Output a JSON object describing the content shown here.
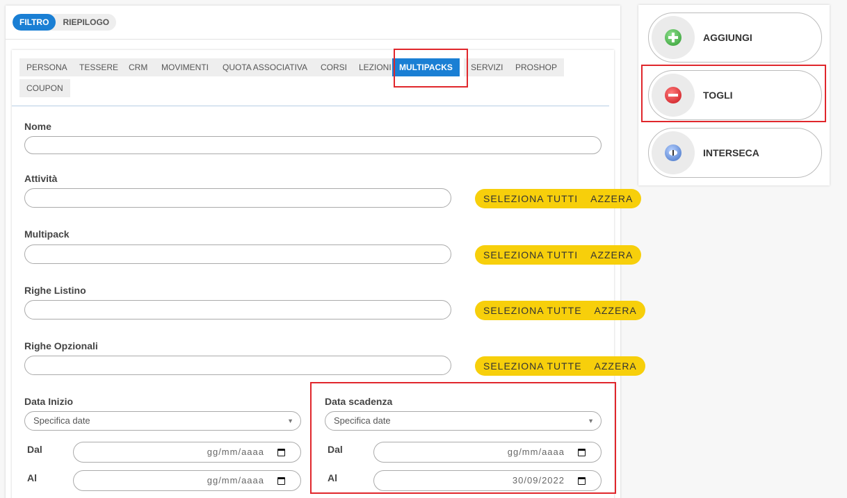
{
  "top_tabs": [
    "FILTRO",
    "RIEPILOGO"
  ],
  "sub_tabs": {
    "persona": "PERSONA",
    "tessere": "TESSERE",
    "crm": "CRM",
    "movimenti": "MOVIMENTI",
    "quota": "QUOTA ASSOCIATIVA",
    "corsi": "CORSI",
    "lezioni": "LEZIONI",
    "multipacks": "MULTIPACKS",
    "servizi": "SERVIZI",
    "proshop": "PROSHOP",
    "coupon": "COUPON"
  },
  "active_sub_tab": "MULTIPACKS",
  "form": {
    "nome": {
      "label": "Nome",
      "value": ""
    },
    "attivita": {
      "label": "Attività",
      "value": "",
      "select_all": "SELEZIONA TUTTI",
      "reset": "AZZERA"
    },
    "multipack": {
      "label": "Multipack",
      "value": "",
      "select_all": "SELEZIONA TUTTI",
      "reset": "AZZERA"
    },
    "righe_listino": {
      "label": "Righe Listino",
      "value": "",
      "select_all": "SELEZIONA TUTTE",
      "reset": "AZZERA"
    },
    "righe_opzionali": {
      "label": "Righe Opzionali",
      "value": "",
      "select_all": "SELEZIONA TUTTE",
      "reset": "AZZERA"
    },
    "data_inizio": {
      "label": "Data Inizio",
      "select": "Specifica date",
      "dal_label": "Dal",
      "dal_value": "gg/mm/aaaa",
      "al_label": "Al",
      "al_value": "gg/mm/aaaa"
    },
    "data_scadenza": {
      "label": "Data scadenza",
      "select": "Specifica date",
      "dal_label": "Dal",
      "dal_value": "gg/mm/aaaa",
      "al_label": "Al",
      "al_value": "30/09/2022"
    }
  },
  "operations": {
    "aggiungi": {
      "label": "AGGIUNGI",
      "icon": "plus-icon",
      "color": "#3aa63a"
    },
    "togli": {
      "label": "TOGLI",
      "icon": "minus-icon",
      "color": "#d8232a"
    },
    "interseca": {
      "label": "INTERSECA",
      "icon": "intersect-icon",
      "color": "#4a78c8"
    }
  },
  "colors": {
    "accent": "#1a7fd4",
    "button_yellow": "#f7cf0b",
    "highlight_red": "#e0262b"
  }
}
